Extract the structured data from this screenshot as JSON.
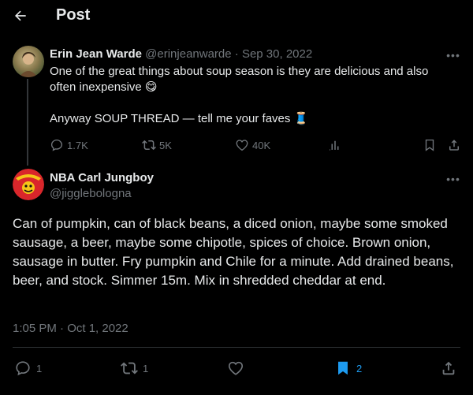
{
  "header": {
    "title": "Post"
  },
  "original_post": {
    "author_name": "Erin Jean Warde",
    "author_handle": "@erinjeanwarde",
    "date": "Sep 30, 2022",
    "separator": "·",
    "text_line1": "One of the great things about soup season is they are delicious and also often inexpensive",
    "emoji1": "😋",
    "text_line2": "Anyway SOUP THREAD — tell me your faves",
    "emoji2": "🧵",
    "stats": {
      "replies": "1.7K",
      "reposts": "5K",
      "likes": "40K"
    }
  },
  "reply_post": {
    "author_name": "NBA Carl Jungboy",
    "author_handle": "@jigglebologna",
    "body": "Can of pumpkin, can of black beans, a diced onion, maybe some smoked sausage, a beer, maybe some chipotle, spices of choice. Brown onion, sausage in butter. Fry pumpkin and Chile for a minute. Add drained beans, beer, and stock. Simmer 15m. Mix in shredded cheddar at end.",
    "timestamp": "1:05 PM · Oct 1, 2022",
    "stats": {
      "replies": "1",
      "reposts": "1",
      "likes": "",
      "bookmarks": "2"
    }
  },
  "colors": {
    "background": "#000000",
    "text": "#e7e9ea",
    "muted": "#71767b",
    "accent": "#1d9bf0",
    "divider": "#2f3336"
  }
}
